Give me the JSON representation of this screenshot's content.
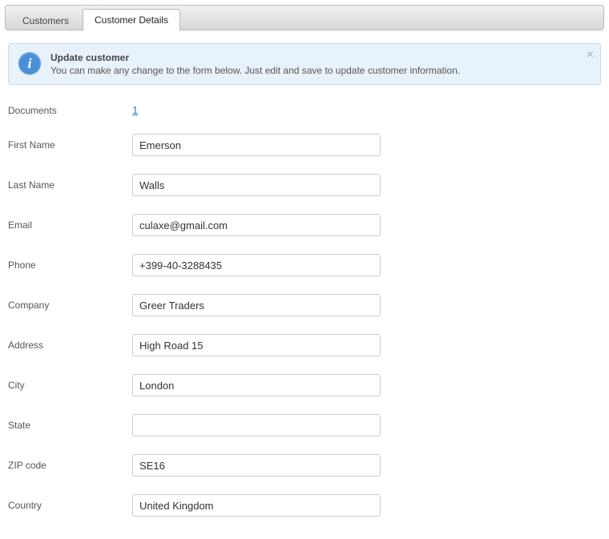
{
  "tabs": [
    {
      "label": "Customers"
    },
    {
      "label": "Customer Details"
    }
  ],
  "info": {
    "title": "Update customer",
    "body": "You can make any change to the form below. Just edit and save to update customer information."
  },
  "form": {
    "documents": {
      "label": "Documents",
      "value": "1"
    },
    "first_name": {
      "label": "First Name",
      "value": "Emerson"
    },
    "last_name": {
      "label": "Last Name",
      "value": "Walls"
    },
    "email": {
      "label": "Email",
      "value": "culaxe@gmail.com"
    },
    "phone": {
      "label": "Phone",
      "value": "+399-40-3288435"
    },
    "company": {
      "label": "Company",
      "value": "Greer Traders"
    },
    "address": {
      "label": "Address",
      "value": "High Road 15"
    },
    "city": {
      "label": "City",
      "value": "London"
    },
    "state": {
      "label": "State",
      "value": ""
    },
    "zip": {
      "label": "ZIP code",
      "value": "SE16"
    },
    "country": {
      "label": "Country",
      "value": "United Kingdom"
    }
  }
}
